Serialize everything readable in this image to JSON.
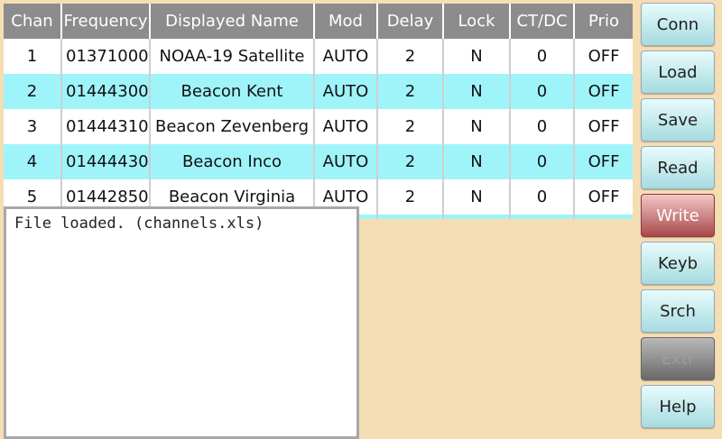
{
  "table": {
    "columns": [
      "Chan",
      "Frequency",
      "Displayed Name",
      "Mod",
      "Delay",
      "Lock",
      "CT/DC",
      "Prio"
    ],
    "rows": [
      [
        "1",
        "01371000",
        "NOAA-19 Satellite",
        "AUTO",
        "2",
        "N",
        "0",
        "OFF"
      ],
      [
        "2",
        "01444300",
        "Beacon Kent",
        "AUTO",
        "2",
        "N",
        "0",
        "OFF"
      ],
      [
        "3",
        "01444310",
        "Beacon Zevenberg",
        "AUTO",
        "2",
        "N",
        "0",
        "OFF"
      ],
      [
        "4",
        "01444430",
        "Beacon Inco",
        "AUTO",
        "2",
        "N",
        "0",
        "OFF"
      ],
      [
        "5",
        "01442850",
        "Beacon Virginia",
        "AUTO",
        "2",
        "N",
        "0",
        "OFF"
      ],
      [
        "",
        "",
        "",
        "",
        "",
        "",
        "",
        ""
      ]
    ]
  },
  "log": {
    "text": "File loaded. (channels.xls)"
  },
  "buttons": {
    "conn": "Conn",
    "load": "Load",
    "save": "Save",
    "read": "Read",
    "write": "Write",
    "keyb": "Keyb",
    "srch": "Srch",
    "extr": "Extr",
    "help": "Help"
  },
  "colors": {
    "background": "#f5deb3",
    "header": "#8c8c8c",
    "row_alt": "#9ff4fa",
    "write_button": "#a9494b"
  }
}
